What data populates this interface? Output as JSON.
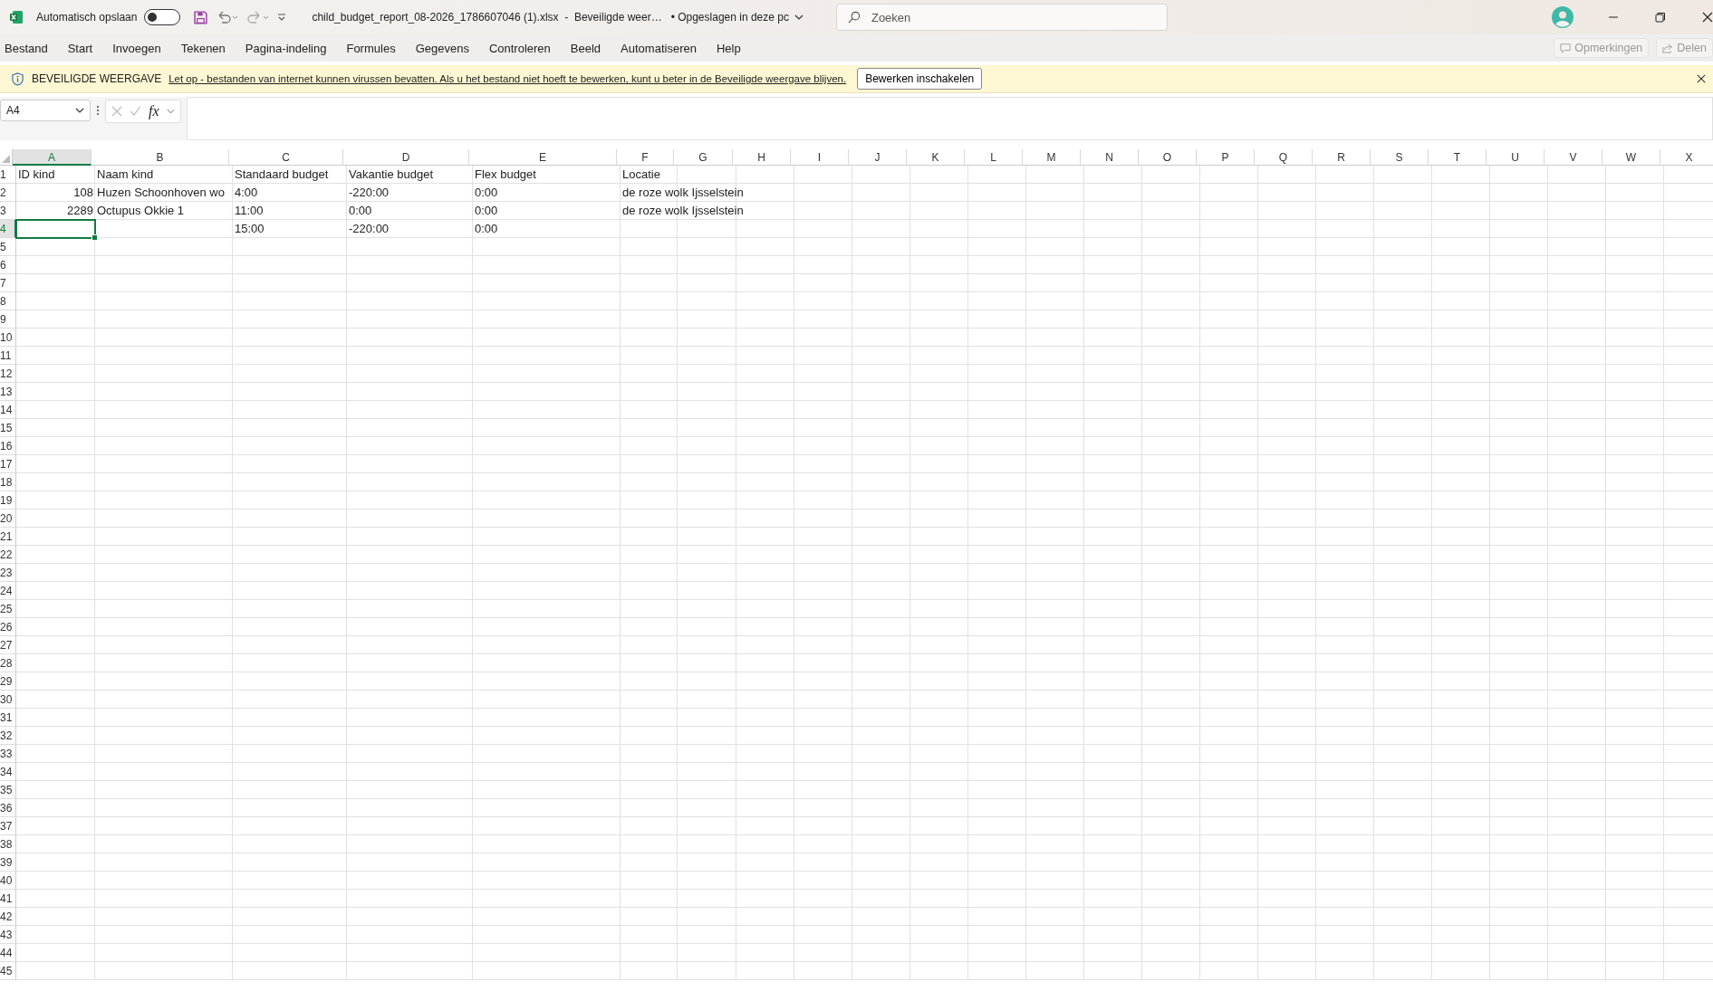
{
  "titlebar": {
    "autosave_label": "Automatisch opslaan",
    "autosave_on": false,
    "title": "child_budget_report_08-2026_1786607046 (1).xlsx  -  Beveiligde weer…",
    "save_status": "• Opgeslagen in deze pc"
  },
  "search": {
    "placeholder": "Zoeken"
  },
  "menu": [
    {
      "label": "Bestand"
    },
    {
      "label": "Start"
    },
    {
      "label": "Invoegen"
    },
    {
      "label": "Tekenen"
    },
    {
      "label": "Pagina-indeling"
    },
    {
      "label": "Formules"
    },
    {
      "label": "Gegevens"
    },
    {
      "label": "Controleren"
    },
    {
      "label": "Beeld"
    },
    {
      "label": "Automatiseren"
    },
    {
      "label": "Help"
    }
  ],
  "ribbon_actions": [
    {
      "label": "Opmerkingen",
      "disabled": true
    },
    {
      "label": "Delen",
      "disabled": true
    }
  ],
  "protected_view": {
    "title": "BEVEILIGDE WEERGAVE",
    "message": "Let op - bestanden van internet kunnen virussen bevatten. Als u het bestand niet hoeft te bewerken, kunt u beter in de Beveiligde weergave blijven.",
    "button": "Bewerken inschakelen"
  },
  "formula_bar": {
    "name_box": "A4",
    "function_label": "fx"
  },
  "columns": [
    {
      "letter": "A",
      "selected": true
    },
    {
      "letter": "B",
      "selected": false
    },
    {
      "letter": "C",
      "selected": false
    },
    {
      "letter": "D",
      "selected": false
    },
    {
      "letter": "E",
      "selected": false
    },
    {
      "letter": "F",
      "selected": false
    },
    {
      "letter": "G",
      "selected": false
    },
    {
      "letter": "H",
      "selected": false
    },
    {
      "letter": "I",
      "selected": false
    },
    {
      "letter": "J",
      "selected": false
    },
    {
      "letter": "K",
      "selected": false
    },
    {
      "letter": "L",
      "selected": false
    },
    {
      "letter": "M",
      "selected": false
    },
    {
      "letter": "N",
      "selected": false
    },
    {
      "letter": "O",
      "selected": false
    },
    {
      "letter": "P",
      "selected": false
    },
    {
      "letter": "Q",
      "selected": false
    },
    {
      "letter": "R",
      "selected": false
    },
    {
      "letter": "S",
      "selected": false
    },
    {
      "letter": "T",
      "selected": false
    },
    {
      "letter": "U",
      "selected": false
    },
    {
      "letter": "V",
      "selected": false
    },
    {
      "letter": "W",
      "selected": false
    },
    {
      "letter": "X",
      "selected": false
    }
  ],
  "rows": [
    {
      "number": "1",
      "selected": false,
      "cells": [
        {
          "text": "ID kind",
          "kind": "text"
        },
        {
          "text": "Naam kind",
          "kind": "text"
        },
        {
          "text": "Standaard budget",
          "kind": "text"
        },
        {
          "text": "Vakantie budget",
          "kind": "text"
        },
        {
          "text": "Flex budget",
          "kind": "text"
        },
        {
          "text": "Locatie",
          "kind": "text"
        }
      ]
    },
    {
      "number": "2",
      "selected": false,
      "cells": [
        {
          "text": "108",
          "kind": "number"
        },
        {
          "text": "Huzen Schoonhoven  wo",
          "kind": "text"
        },
        {
          "text": "4:00",
          "kind": "text"
        },
        {
          "text": "-220:00",
          "kind": "text"
        },
        {
          "text": "0:00",
          "kind": "text"
        },
        {
          "text": "de roze wolk Ijsselstein",
          "kind": "text"
        }
      ]
    },
    {
      "number": "3",
      "selected": false,
      "cells": [
        {
          "text": "2289",
          "kind": "number"
        },
        {
          "text": "Octupus  Okkie 1",
          "kind": "text"
        },
        {
          "text": "11:00",
          "kind": "text"
        },
        {
          "text": "0:00",
          "kind": "text"
        },
        {
          "text": "0:00",
          "kind": "text"
        },
        {
          "text": "de roze wolk Ijsselstein",
          "kind": "text"
        }
      ]
    },
    {
      "number": "4",
      "selected": true,
      "cells": [
        null,
        null,
        {
          "text": "15:00",
          "kind": "text"
        },
        {
          "text": "-220:00",
          "kind": "text"
        },
        {
          "text": "0:00",
          "kind": "text"
        }
      ]
    },
    {
      "number": "5",
      "selected": false
    },
    {
      "number": "6",
      "selected": false
    },
    {
      "number": "7",
      "selected": false
    },
    {
      "number": "8",
      "selected": false
    },
    {
      "number": "9",
      "selected": false
    },
    {
      "number": "10",
      "selected": false
    },
    {
      "number": "11",
      "selected": false
    },
    {
      "number": "12",
      "selected": false
    },
    {
      "number": "13",
      "selected": false
    },
    {
      "number": "14",
      "selected": false
    },
    {
      "number": "15",
      "selected": false
    },
    {
      "number": "16",
      "selected": false
    },
    {
      "number": "17",
      "selected": false
    },
    {
      "number": "18",
      "selected": false
    },
    {
      "number": "19",
      "selected": false
    },
    {
      "number": "20",
      "selected": false
    },
    {
      "number": "21",
      "selected": false
    },
    {
      "number": "22",
      "selected": false
    },
    {
      "number": "23",
      "selected": false
    },
    {
      "number": "24",
      "selected": false
    },
    {
      "number": "25",
      "selected": false
    },
    {
      "number": "26",
      "selected": false
    },
    {
      "number": "27",
      "selected": false
    },
    {
      "number": "28",
      "selected": false
    },
    {
      "number": "29",
      "selected": false
    },
    {
      "number": "30",
      "selected": false
    },
    {
      "number": "31",
      "selected": false
    },
    {
      "number": "32",
      "selected": false
    },
    {
      "number": "33",
      "selected": false
    },
    {
      "number": "34",
      "selected": false
    },
    {
      "number": "35",
      "selected": false
    },
    {
      "number": "36",
      "selected": false
    },
    {
      "number": "37",
      "selected": false
    },
    {
      "number": "38",
      "selected": false
    },
    {
      "number": "39",
      "selected": false
    },
    {
      "number": "40",
      "selected": false
    },
    {
      "number": "41",
      "selected": false
    },
    {
      "number": "42",
      "selected": false
    },
    {
      "number": "43",
      "selected": false
    },
    {
      "number": "44",
      "selected": false
    },
    {
      "number": "45",
      "selected": false
    }
  ]
}
